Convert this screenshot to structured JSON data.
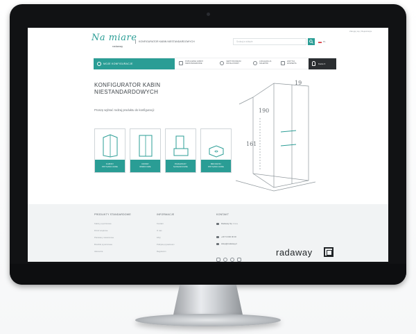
{
  "header": {
    "top_links": "Zaloguj się | Rejestracja",
    "logo_script": "Na miare",
    "logo_sub": "radaway",
    "tagline": "KONFIGURATOR KABIN NIESTANDARDOWYCH",
    "search_placeholder": "Szukaj w sklepie",
    "language": "PL"
  },
  "nav": {
    "main_label": "MOJE KONFIGURACJE",
    "items": [
      {
        "label": "POPULARNE KABINY",
        "label2": "NIESTANDARDOWE"
      },
      {
        "label": "CERTYFIKOWANI",
        "label2": "INSTALATORZY"
      },
      {
        "label": "LOKALIZACJA",
        "label2": "SKLEPÓW"
      },
      {
        "label": "ZAPYTAJ",
        "label2": "EKSPERTA"
      }
    ],
    "account_label": "Konto"
  },
  "main": {
    "title": "KONFIGURATOR KABIN NIESTANDARDOWYCH",
    "lead": "Proszę wybrać rodzaj produktu do konfiguracji:",
    "cards": [
      {
        "line1": "KABINY",
        "line2": "PRYSZNICOWE"
      },
      {
        "line1": "DRZWI",
        "line2": "WNĘKOWE"
      },
      {
        "line1": "PARAWANY",
        "line2": "NAWANNOWE"
      },
      {
        "line1": "BRODZIKI",
        "line2": "PRYSZNICOWE"
      }
    ],
    "sketch_dims": {
      "top": "19",
      "slope": "190",
      "height": "161"
    }
  },
  "footer": {
    "col1_title": "PRODUKTY STANDARDOWE",
    "col1_items": [
      "Kabiny prysznicowe",
      "Drzwi wnękowe",
      "Parawany nawannowe",
      "Brodziki prysznicowe",
      "Akcesoria"
    ],
    "col2_title": "INFORMACJE",
    "col2_items": [
      "Kontakt",
      "O nas",
      "FAQ",
      "Polityka prywatności",
      "Regulamin"
    ],
    "col3_title": "KONTAKT",
    "company": "Radaway Sp. z o.o.",
    "phone": "+48 74 000 00 00",
    "email": "sklep@radaway.pl",
    "brand": "radaway"
  },
  "colors": {
    "accent": "#2a9d95",
    "dark": "#2b2e31",
    "footer_bg": "#f1f3f4"
  }
}
